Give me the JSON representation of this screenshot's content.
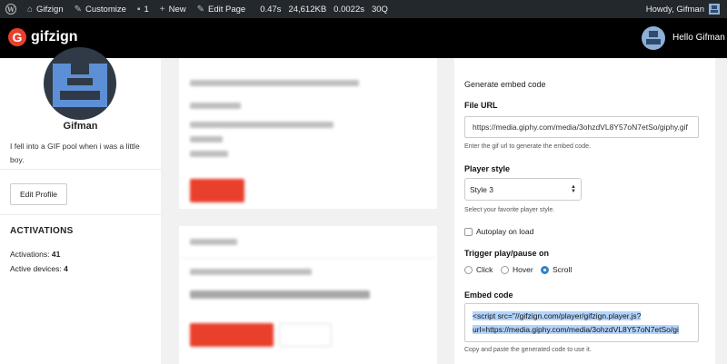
{
  "adminbar": {
    "site_name": "Gifzign",
    "customize": "Customize",
    "comments_count": "1",
    "new": "New",
    "edit_page": "Edit Page",
    "stats": [
      "0.47s",
      "24,612KB",
      "0.0022s",
      "30Q"
    ],
    "greeting": "Howdy, Gifman"
  },
  "header": {
    "logo_letter": "G",
    "logo_text": "gifzign",
    "user_greeting": "Hello Gifman"
  },
  "profile": {
    "name": "Gifman",
    "bio": "I fell into a GIF pool when i was a little boy.",
    "edit_button": "Edit Profile",
    "activations_title": "ACTIVATIONS",
    "activations_label": "Activations:",
    "activations_value": "41",
    "devices_label": "Active devices:",
    "devices_value": "4"
  },
  "embed": {
    "heading": "Generate embed code",
    "file_url_label": "File URL",
    "file_url_value": "https://media.giphy.com/media/3ohzdVL8Y57oN7etSo/giphy.gif",
    "file_url_help": "Enter the gif url to generate the embed code.",
    "player_style_label": "Player style",
    "player_style_value": "Style 3",
    "player_style_help": "Select your favorite player style.",
    "autoplay_label": "Autoplay on load",
    "trigger_label": "Trigger play/pause on",
    "trigger_options": [
      "Click",
      "Hover",
      "Scroll"
    ],
    "trigger_selected": "Scroll",
    "embed_code_label": "Embed code",
    "embed_code_line1": "<script src=\"//gifzign.com/player/gifzign.player.js?",
    "embed_code_line2": "url=https://media.giphy.com/media/3ohzdVL8Y57oN7etSo/gi",
    "embed_code_help": "Copy and paste the generated code to use it."
  },
  "colors": {
    "accent": "#e8402d",
    "radio_checked": "#3582c4",
    "selection": "#b3d4fc"
  }
}
